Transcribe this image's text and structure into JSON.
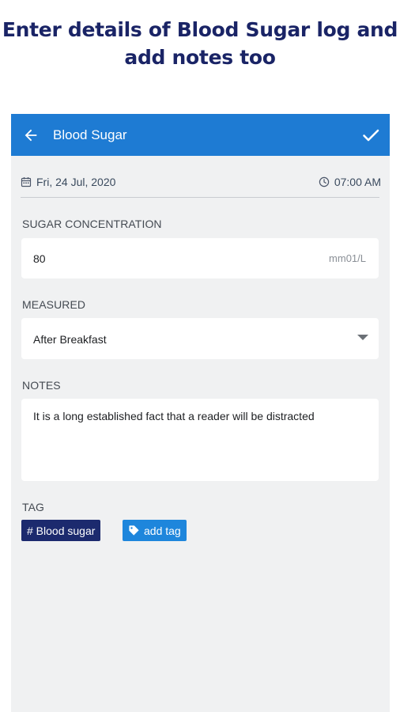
{
  "promo": {
    "line1": "Enter details of Blood Sugar log and",
    "line2": "add notes too"
  },
  "app_bar": {
    "title": "Blood Sugar",
    "back_icon": "arrow-left-icon",
    "confirm_icon": "check-icon"
  },
  "datetime": {
    "date": "Fri, 24 Jul, 2020",
    "time": "07:00 AM"
  },
  "sugar": {
    "label": "SUGAR CONCENTRATION",
    "value": "80",
    "unit": "mm01/L"
  },
  "measured": {
    "label": "MEASURED",
    "value": "After Breakfast"
  },
  "notes": {
    "label": "NOTES",
    "text": "It is a long established fact that a reader will be distracted"
  },
  "tags": {
    "label": "TAG",
    "items": [
      {
        "label": "# Blood sugar"
      },
      {
        "label": "add tag"
      }
    ]
  },
  "colors": {
    "app_bar": "#1e7bd3",
    "title_navy": "#1a2466",
    "tag_dark": "#1c2a6e",
    "tag_light": "#1e86dc"
  }
}
